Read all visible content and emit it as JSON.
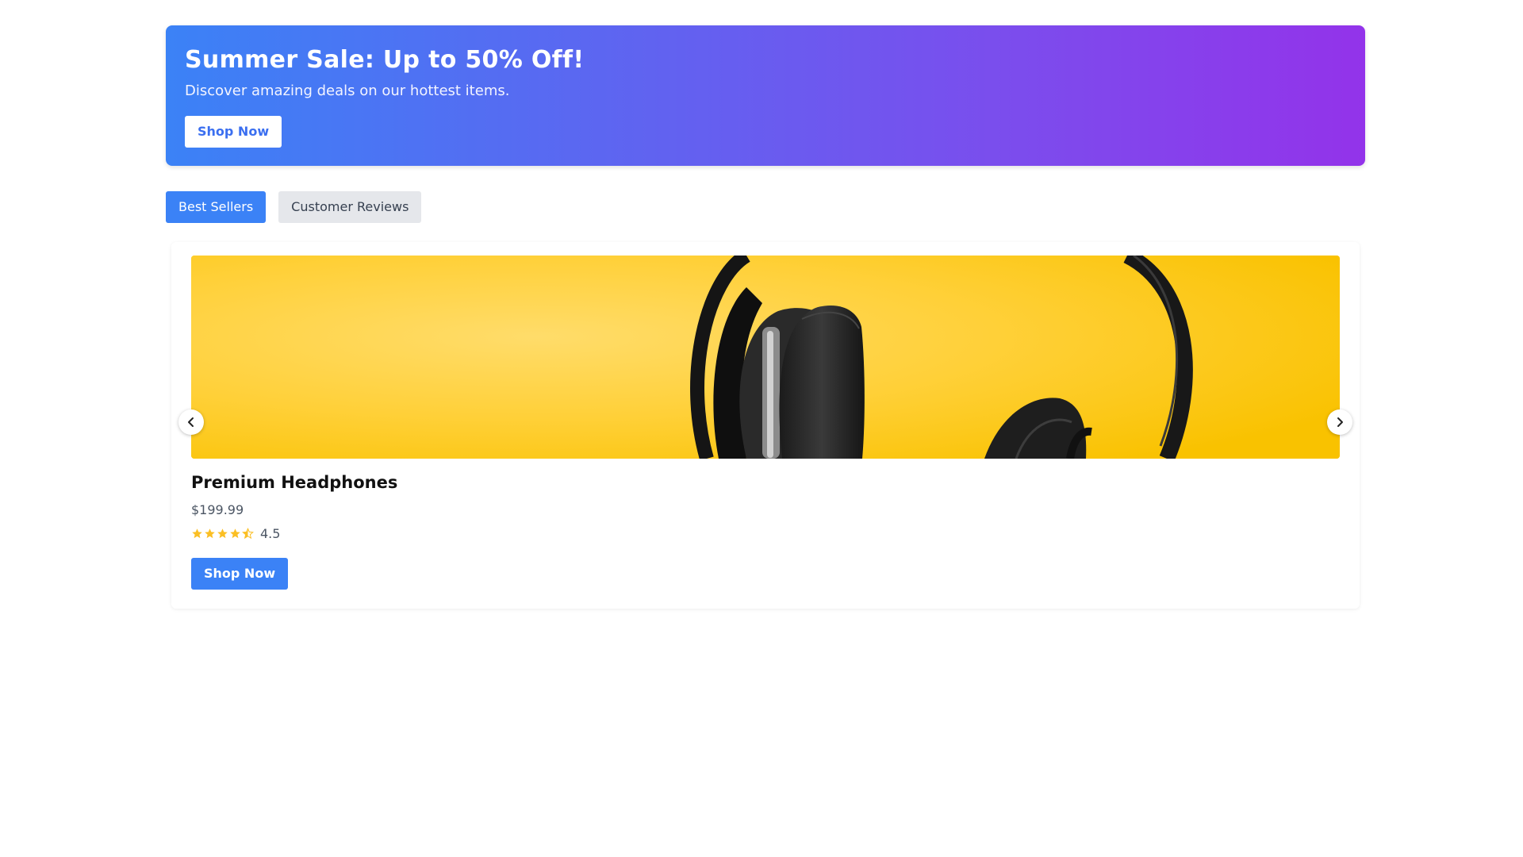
{
  "hero": {
    "title": "Summer Sale: Up to 50% Off!",
    "subtitle": "Discover amazing deals on our hottest items.",
    "button_label": "Shop Now",
    "gradient_start": "#3b82f6",
    "gradient_end": "#9333ea"
  },
  "tabs": [
    {
      "label": "Best Sellers",
      "active": true
    },
    {
      "label": "Customer Reviews",
      "active": false
    }
  ],
  "carousel": {
    "prev_icon": "chevron-left-icon",
    "next_icon": "chevron-right-icon",
    "current_item": {
      "image_subject": "black headphones on yellow background",
      "name": "Premium Headphones",
      "price": "$199.99",
      "rating": 4.5,
      "rating_label": "4.5",
      "rating_max": 5,
      "star_color": "#fbbf24",
      "button_label": "Shop Now"
    }
  },
  "colors": {
    "accent": "#3b82f6",
    "tab_inactive_bg": "#e5e7eb"
  }
}
